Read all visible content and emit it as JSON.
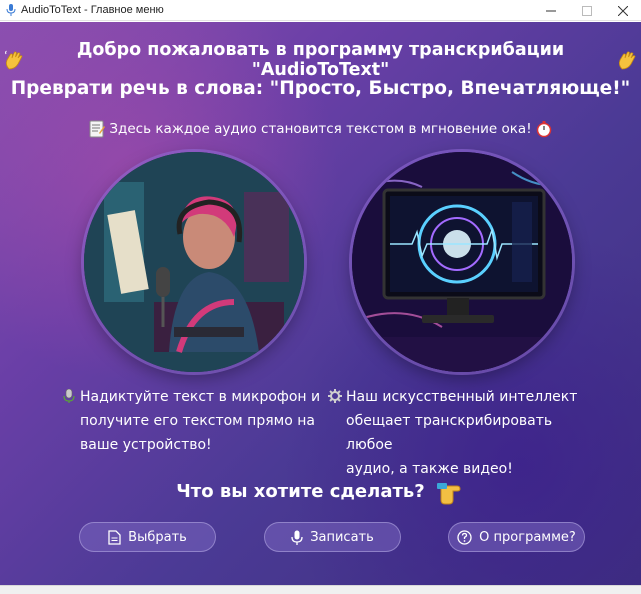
{
  "window": {
    "title": "AudioToText - Главное меню"
  },
  "header": {
    "welcome": "Добро пожаловать в программу транскрибации \"AudioToText\"",
    "slogan": "Преврати речь в слова: \"Просто, Быстро, Впечатляюще!\"",
    "tagline": "Здесь каждое аудио становится текстом в мгновение ока!"
  },
  "features": {
    "left": {
      "line1": "Надиктуйте текст в микрофон и",
      "line2": "получите его текстом прямо на",
      "line3": "ваше устройство!"
    },
    "right": {
      "line1": "Наш искусственный интеллект",
      "line2": "обещает транскрибировать любое",
      "line3": "аудио, а также видео!"
    }
  },
  "prompt": {
    "question": "Что вы хотите сделать?"
  },
  "buttons": {
    "choose": "Выбрать",
    "record": "Записать",
    "about": "О программе?"
  },
  "icons": {
    "app": "microphone-icon",
    "wave": "waving-hand-icon",
    "notes": "memo-icon",
    "timer": "stopwatch-icon",
    "mic": "microphone-icon",
    "gear": "gear-icon",
    "pointer": "pointing-hand-icon",
    "file": "file-icon",
    "help": "question-circle-icon"
  },
  "colors": {
    "background_start": "#8a4fb0",
    "background_end": "#3d2f7e",
    "button_fill": "#7864be"
  }
}
